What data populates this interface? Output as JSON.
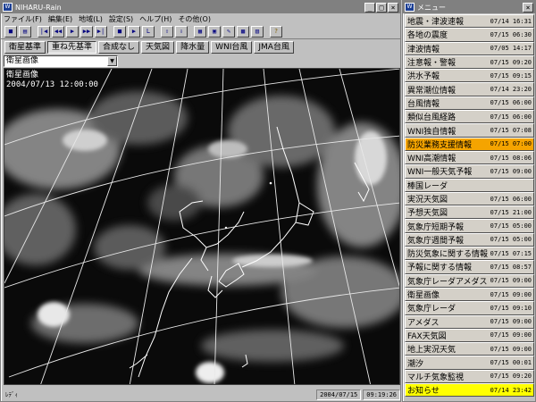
{
  "main": {
    "title": "NIHARU-Rain",
    "menu": [
      "ファイル(F)",
      "編集(E)",
      "地域(L)",
      "設定(S)",
      "ヘルプ(H)",
      "その他(O)"
    ],
    "toolbar_icons": [
      "save-icon",
      "print-icon",
      "first-frame-icon",
      "prev-frame-icon",
      "play-icon",
      "next-frame-icon",
      "last-frame-icon",
      "stop-icon",
      "step-icon",
      "loop-icon",
      "up-icon",
      "down-icon",
      "copy-icon",
      "export-icon",
      "settings-icon",
      "palette-icon",
      "info-icon",
      "help-icon"
    ],
    "layers": [
      "衛星基準",
      "重ね先基準",
      "合成なし",
      "天気図",
      "降水量",
      "WNI台風",
      "JMA台風"
    ],
    "active_layer": "重ね先基準",
    "select_value": "衛星画像",
    "map_title": "衛星画像",
    "map_time": "2004/07/13 12:00:00",
    "status_left": "ﾚﾃﾞｨ",
    "status_date": "2004/07/15",
    "status_time": "09:19:26"
  },
  "menu_window": {
    "title": "メニュー",
    "items": [
      {
        "label": "地震・津波速報",
        "time": "07/14 16:31",
        "hl": ""
      },
      {
        "label": "各地の震度",
        "time": "07/15 06:30",
        "hl": ""
      },
      {
        "label": "津波情報",
        "time": "07/05 14:17",
        "hl": ""
      },
      {
        "label": "注意報・警報",
        "time": "07/15 09:20",
        "hl": ""
      },
      {
        "label": "洪水予報",
        "time": "07/15 09:15",
        "hl": ""
      },
      {
        "label": "異常潮位情報",
        "time": "07/14 23:20",
        "hl": ""
      },
      {
        "label": "台風情報",
        "time": "07/15 06:00",
        "hl": ""
      },
      {
        "label": "類似台風経路",
        "time": "07/15 06:00",
        "hl": ""
      },
      {
        "label": "WNI独自情報",
        "time": "07/15 07:08",
        "hl": ""
      },
      {
        "label": "防災業務支援情報",
        "time": "07/15 07:00",
        "hl": "orange"
      },
      {
        "label": "WNI高潮情報",
        "time": "07/15 08:06",
        "hl": ""
      },
      {
        "label": "WNI一般天気予報",
        "time": "07/15 09:00",
        "hl": ""
      },
      {
        "label": "棒国レーダ",
        "time": "",
        "hl": ""
      },
      {
        "label": "実況天気図",
        "time": "07/15 06:00",
        "hl": ""
      },
      {
        "label": "予想天気図",
        "time": "07/15 21:00",
        "hl": ""
      },
      {
        "label": "気象庁短期予報",
        "time": "07/15 05:00",
        "hl": ""
      },
      {
        "label": "気象庁週間予報",
        "time": "07/15 05:00",
        "hl": ""
      },
      {
        "label": "防災気象に関する情報",
        "time": "07/15 07:15",
        "hl": ""
      },
      {
        "label": "予報に関する情報",
        "time": "07/15 08:57",
        "hl": ""
      },
      {
        "label": "気象庁レーダアメダス",
        "time": "07/15 09:00",
        "hl": ""
      },
      {
        "label": "衛星画像",
        "time": "07/15 09:00",
        "hl": ""
      },
      {
        "label": "気象庁レーダ",
        "time": "07/15 09:10",
        "hl": ""
      },
      {
        "label": "アメダス",
        "time": "07/15 09:00",
        "hl": ""
      },
      {
        "label": "FAX天気図",
        "time": "07/15 09:00",
        "hl": ""
      },
      {
        "label": "地上実況天気",
        "time": "07/15 09:00",
        "hl": ""
      },
      {
        "label": "潮汐",
        "time": "07/15 00:01",
        "hl": ""
      },
      {
        "label": "マルチ気象監視",
        "time": "07/15 09:20",
        "hl": ""
      },
      {
        "label": "お知らせ",
        "time": "07/14 23:42",
        "hl": "yellow"
      }
    ]
  }
}
